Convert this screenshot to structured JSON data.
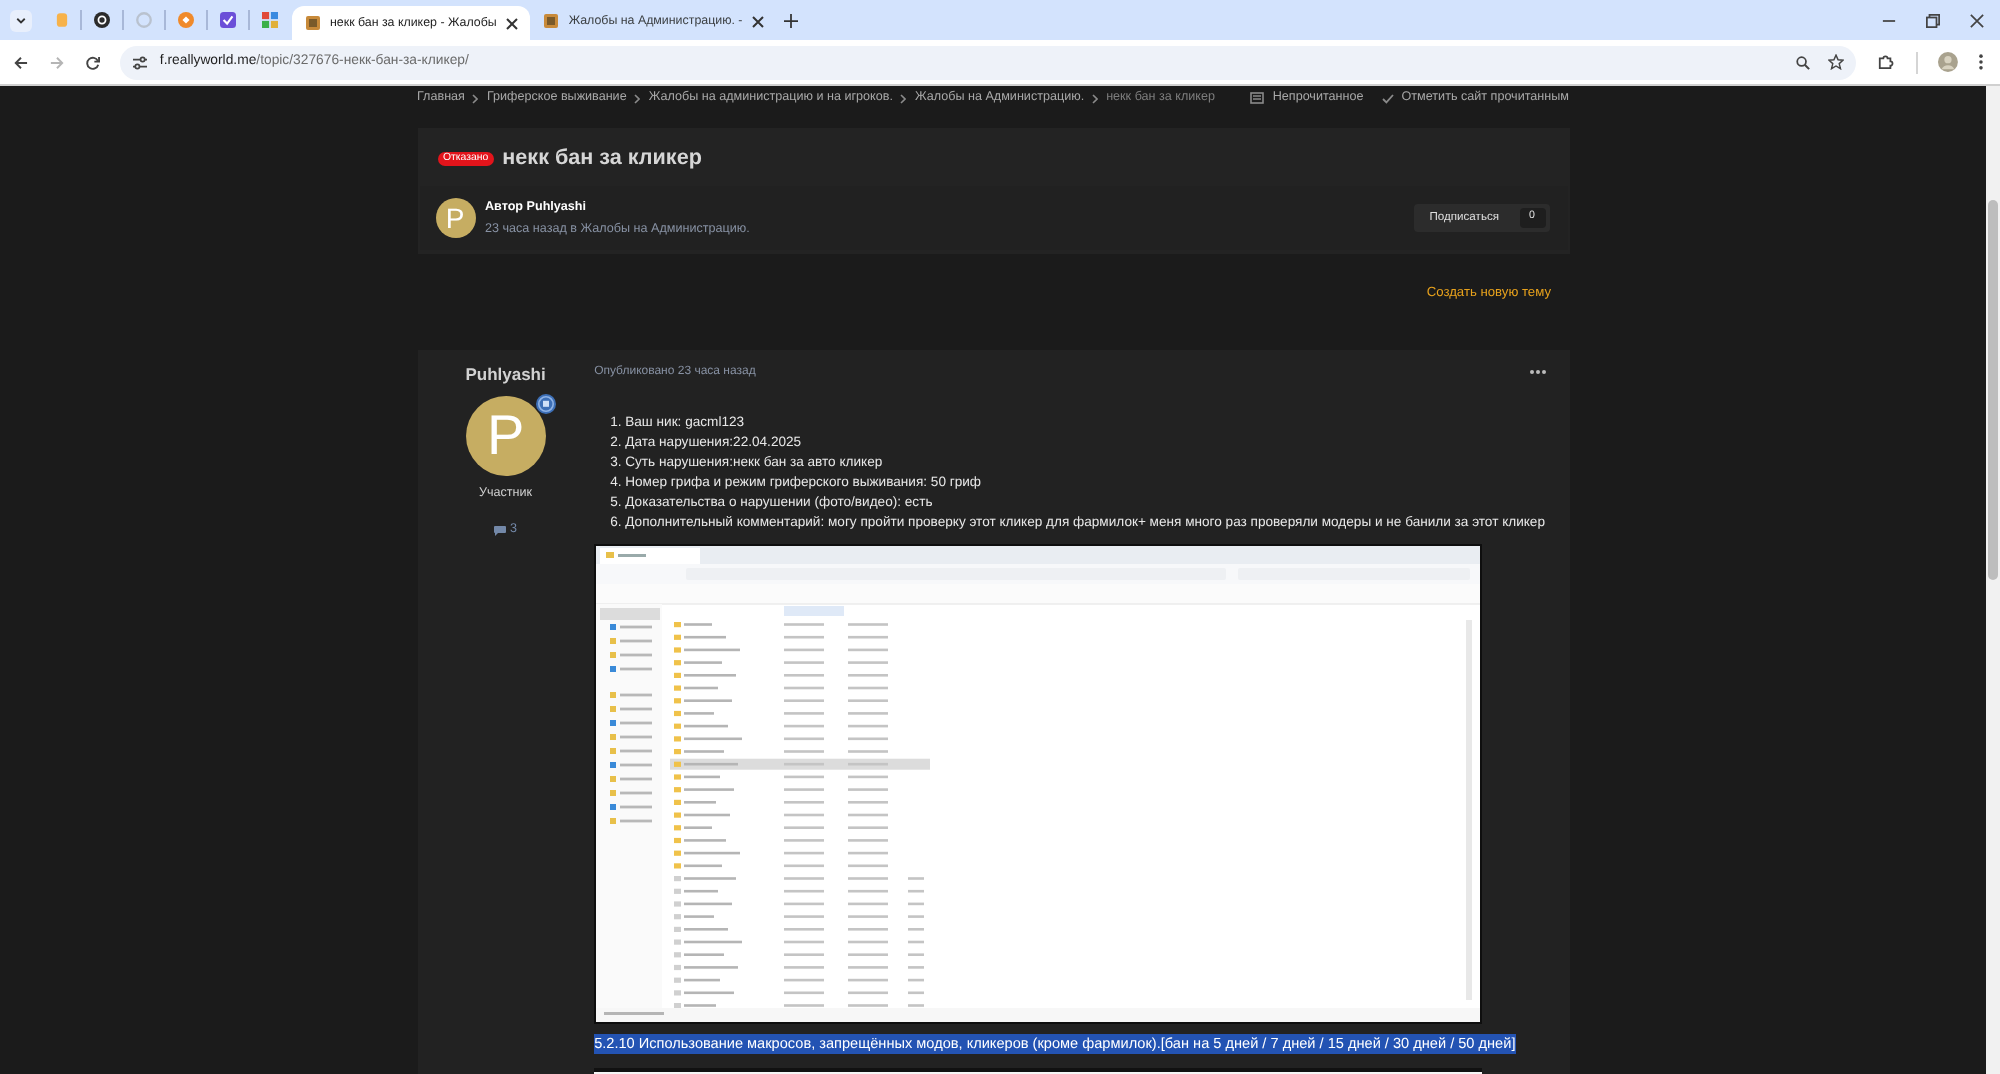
{
  "browser": {
    "tabs": [
      {
        "title": "некк бан за кликер - Жалобы",
        "selected": true
      },
      {
        "title": "Жалобы на Администрацию. -",
        "selected": false
      }
    ],
    "url_host": "f.reallyworld.me",
    "url_path": "/topic/327676-некк-бан-за-кликер/"
  },
  "breadcrumb": [
    "Главная",
    "Гриферское выживание",
    "Жалобы на администрацию и на игроков.",
    "Жалобы на Администрацию.",
    "некк бан за кликер"
  ],
  "header_links": [
    {
      "kind": "unread",
      "label": "Непрочитанное"
    },
    {
      "kind": "mark-read",
      "label": "Отметить сайт прочитанным"
    }
  ],
  "topic": {
    "status": "Отказано",
    "title": "некк бан за кликер",
    "avatar_letter": "P",
    "author": "Автор Puhlyashi",
    "meta": "23 часа назад в Жалобы на Администрацию.",
    "subscribe": {
      "label": "Подписаться",
      "count": "0"
    }
  },
  "create_topic": "Создать новую тему",
  "post": {
    "author": "Puhlyashi",
    "avatar_letter": "P",
    "role": "Участник",
    "post_count": "3",
    "published": "Опубликовано 23 часа назад",
    "lines": [
      "1. Ваш ник: gacml123",
      "2. Дата нарушения:22.04.2025",
      "3. Суть нарушения:некк бан за авто кликер",
      "4. Номер грифа и режим гриферского выживания: 50 гриф",
      "5. Доказательства о нарушении (фото/видео): есть",
      "6. Дополнительный комментарий: могу пройти проверку этот кликер для фармилок+ меня много раз проверяли модеры и не банили за этот кликер"
    ],
    "quote": {
      "text": "5.2.10 Использование макросов, запрещённых модов, кликеров (кроме фармилок).[бан на 5 дней / 7 дней / 15 дней / 30 дней / 50 дней]",
      "selected": true
    }
  }
}
